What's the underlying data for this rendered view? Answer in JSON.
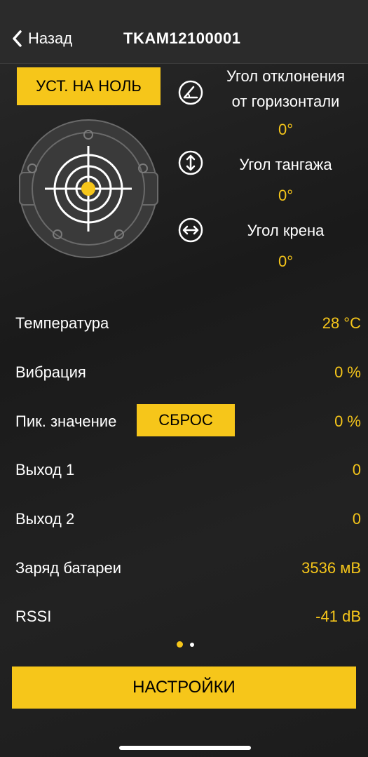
{
  "nav": {
    "back_label": "Назад",
    "title": "TKAM12100001"
  },
  "zero_button": "УСТ. НА НОЛЬ",
  "angles": [
    {
      "icon": "tilt-angle-icon",
      "label_line1": "Угол отклонения",
      "label_line2": "от горизонтали",
      "value": "0°"
    },
    {
      "icon": "vertical-arrows-icon",
      "label_line1": "Угол тангажа",
      "value": "0°"
    },
    {
      "icon": "horizontal-arrows-icon",
      "label_line1": "Угол крена",
      "value": "0°"
    }
  ],
  "rows": [
    {
      "label": "Температура",
      "value": "28 °C"
    },
    {
      "label": "Вибрация",
      "value": "0 %"
    },
    {
      "label": "Пик. значение",
      "value": "0 %"
    },
    {
      "label": "Выход 1",
      "value": "0"
    },
    {
      "label": "Выход 2",
      "value": "0"
    },
    {
      "label": "Заряд батареи",
      "value": "3536 мВ"
    },
    {
      "label": "RSSI",
      "value": "-41 dB"
    }
  ],
  "reset_button": "СБРОС",
  "settings_button": "НАСТРОЙКИ",
  "pager": {
    "count": 2,
    "active": 1
  },
  "colors": {
    "accent": "#f6c61a",
    "background": "#1b1b1b",
    "navbar": "#2b2b2b",
    "text": "#ffffff"
  }
}
